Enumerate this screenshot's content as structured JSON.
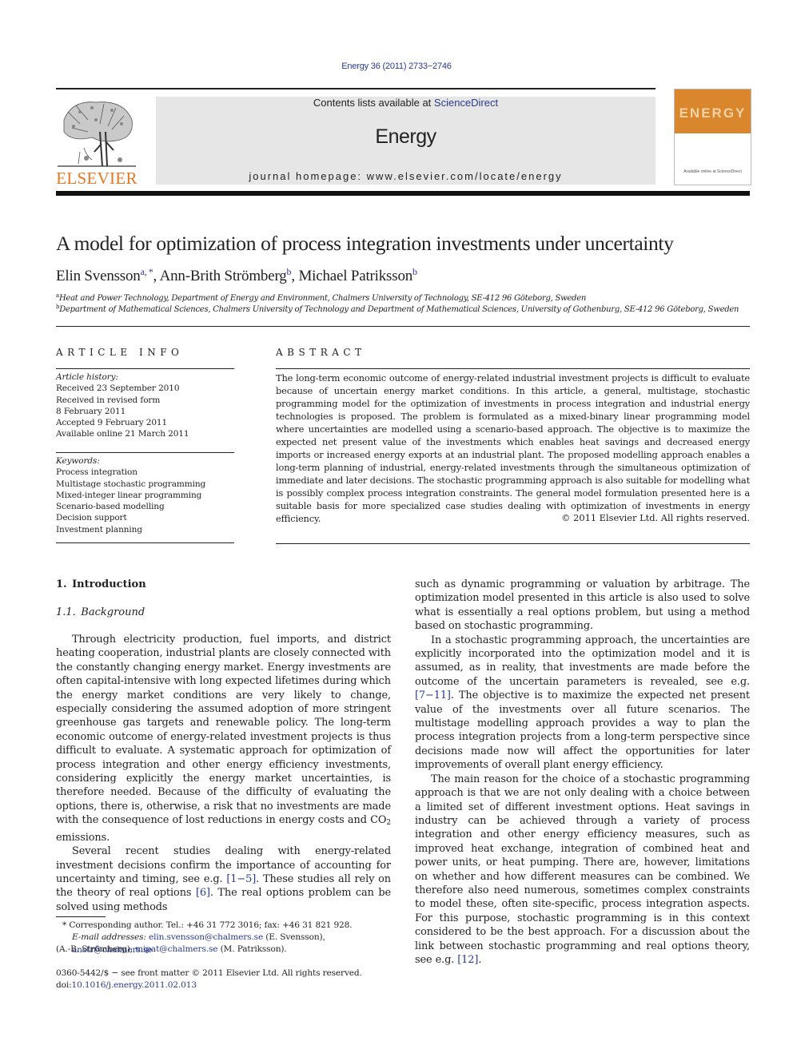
{
  "header": {
    "citation": "Energy 36 (2011) 2733−2746",
    "contents_prefix": "Contents lists available at ",
    "contents_link": "ScienceDirect",
    "journal_name": "Energy",
    "homepage_label": "journal homepage: www.elsevier.com/locate/energy",
    "publisher_logo_text": "ELSEVIER",
    "cover_title": "ENERGY",
    "cover_footer": "Available online at ScienceDirect",
    "colors": {
      "publisher_orange": "#e87722",
      "cover_orange": "#d9862c",
      "link_blue": "#2a3a8c",
      "banner_gray": "#e6e6e6"
    }
  },
  "article": {
    "title": "A model for optimization of process integration investments under uncertainty",
    "authors": [
      {
        "name": "Elin Svensson",
        "marks": "a, *",
        "sep": ", "
      },
      {
        "name": "Ann-Brith Strömberg",
        "marks": "b",
        "sep": ", "
      },
      {
        "name": "Michael Patriksson",
        "marks": "b",
        "sep": ""
      }
    ],
    "affiliations": [
      {
        "mark": "a",
        "text": "Heat and Power Technology, Department of Energy and Environment, Chalmers University of Technology, SE-412 96 Göteborg, Sweden"
      },
      {
        "mark": "b",
        "text": "Department of Mathematical Sciences, Chalmers University of Technology and Department of Mathematical Sciences, University of Gothenburg, SE-412 96 Göteborg, Sweden"
      }
    ]
  },
  "article_info": {
    "heading": "ARTICLE INFO",
    "history_label": "Article history:",
    "history": [
      "Received 23 September 2010",
      "Received in revised form",
      "8 February 2011",
      "Accepted 9 February 2011",
      "Available online 21 March 2011"
    ],
    "keywords_label": "Keywords:",
    "keywords": [
      "Process integration",
      "Multistage stochastic programming",
      "Mixed-integer linear programming",
      "Scenario-based modelling",
      "Decision support",
      "Investment planning"
    ]
  },
  "abstract": {
    "heading": "ABSTRACT",
    "text": "The long-term economic outcome of energy-related industrial investment projects is difficult to evaluate because of uncertain energy market conditions. In this article, a general, multistage, stochastic programming model for the optimization of investments in process integration and industrial energy technologies is proposed. The problem is formulated as a mixed-binary linear programming model where uncertainties are modelled using a scenario-based approach. The objective is to maximize the expected net present value of the investments which enables heat savings and decreased energy imports or increased energy exports at an industrial plant. The proposed modelling approach enables a long-term planning of industrial, energy-related investments through the simultaneous optimization of immediate and later decisions. The stochastic programming approach is also suitable for modelling what is possibly complex process integration constraints. The general model formulation presented here is a suitable basis for more specialized case studies dealing with optimization of investments in energy efficiency.",
    "copyright": "© 2011 Elsevier Ltd. All rights reserved."
  },
  "body": {
    "section_1": "1. Introduction",
    "section_1_1": "1.1. Background",
    "left": {
      "p1_a": "Through electricity production, fuel imports, and district heating cooperation, industrial plants are closely connected with the constantly changing energy market. Energy investments are often capital-intensive with long expected lifetimes during which the energy market conditions are very likely to change, especially considering the assumed adoption of more stringent greenhouse gas targets and renewable policy. The long-term economic outcome of energy-related investment projects is thus difficult to evaluate. A systematic approach for optimization of process integration and other energy efficiency investments, considering explicitly the energy market uncertainties, is therefore needed. Because of the difficulty of evaluating the options, there is, otherwise, a risk that no investments are made with the consequence of lost reductions in energy costs and CO",
      "p1_sub": "2",
      "p1_b": " emissions.",
      "p2_a": "Several recent studies dealing with energy-related investment decisions confirm the importance of accounting for uncertainty and timing, see e.g. ",
      "p2_ref1": "[1−5]",
      "p2_b": ". These studies all rely on the theory of real options ",
      "p2_ref2": "[6]",
      "p2_c": ". The real options problem can be solved using methods"
    },
    "right": {
      "p0": "such as dynamic programming or valuation by arbitrage. The optimization model presented in this article is also used to solve what is essentially a real options problem, but using a method based on stochastic programming.",
      "p1_a": "In a stochastic programming approach, the uncertainties are explicitly incorporated into the optimization model and it is assumed, as in reality, that investments are made before the outcome of the uncertain parameters is revealed, see e.g. ",
      "p1_ref": "[7−11]",
      "p1_b": ". The objective is to maximize the expected net present value of the investments over all future scenarios. The multistage modelling approach provides a way to plan the process integration projects from a long-term perspective since decisions made now will affect the opportunities for later improvements of overall plant energy efficiency.",
      "p2_a": "The main reason for the choice of a stochastic programming approach is that we are not only dealing with a choice between a limited set of different investment options. Heat savings in industry can be achieved through a variety of process integration and other energy efficiency measures, such as improved heat exchange, integration of combined heat and power units, or heat pumping. There are, however, limitations on whether and how different measures can be combined. We therefore also need numerous, sometimes complex constraints to model these, often site-specific, process integration aspects. For this purpose, stochastic programming is in this context considered to be the best approach. For a discussion about the link between stochastic programming and real options theory, see e.g. ",
      "p2_ref": "[12]",
      "p2_b": "."
    }
  },
  "footnotes": {
    "corr_mark": "*",
    "corr_text": " Corresponding author. Tel.: +46 31 772 3016; fax: +46 31 821 928.",
    "email_label": "E-mail addresses:",
    "email1": "elin.svensson@chalmers.se",
    "email1_who": " (E. Svensson), ",
    "email2": "anstr@chalmers.se",
    "email2_who": "(A.-B. Strömberg), ",
    "email3": "mipat@chalmers.se",
    "email3_who": " (M. Patriksson).",
    "front_matter": "0360-5442/$ − see front matter © 2011 Elsevier Ltd. All rights reserved.",
    "doi_label": "doi:",
    "doi": "10.1016/j.energy.2011.02.013"
  }
}
